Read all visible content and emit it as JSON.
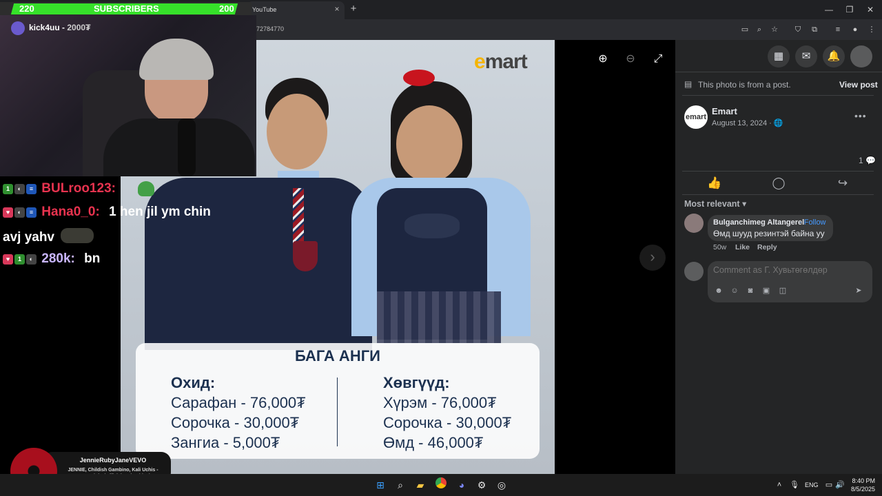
{
  "browser": {
    "tab_title": "YouTube",
    "tab_close": "×",
    "new_tab": "+",
    "url": "72784770",
    "window": {
      "minimize": "—",
      "restore": "❐",
      "close": "✕"
    }
  },
  "stream_overlay": {
    "subscriber_goal": {
      "left": "220",
      "label": "SUBSCRIBERS",
      "right": "200"
    },
    "alert": {
      "user": "kick4uu",
      "separator": " - ",
      "amount": "2000₮"
    },
    "chat": [
      {
        "badges": [
          "1st",
          "mask",
          "flag"
        ],
        "user": "BULroo123:",
        "user_color": "#e8334f",
        "message": ""
      },
      {
        "badges": [
          "heart",
          "mask",
          "flag"
        ],
        "user": "Hana0_0:",
        "user_color": "#e8334f",
        "message": "1 hen jil ym chin"
      },
      {
        "badges": [],
        "user": "avj yahv",
        "user_color": "#ffffff",
        "message": ""
      },
      {
        "badges": [
          "heart",
          "1st",
          "mask"
        ],
        "user": "280k:",
        "user_color": "#ffffff",
        "message": "bn"
      }
    ],
    "now_playing": {
      "title": "JennieRubyJaneVEVO",
      "subtitle": "JENNIE, Childish Gambino, Kali Uchis - Damn Right (Official Lyric Video)"
    }
  },
  "photo": {
    "logo": {
      "e": "e",
      "rest": "mart"
    },
    "card": {
      "title": "БАГА АНГИ",
      "girls": {
        "heading": "Охид:",
        "items": [
          "Сарафан - 76,000₮",
          "Сорочка - 30,000₮",
          "Зангиа - 5,000₮"
        ]
      },
      "boys": {
        "heading": "Хөвгүүд:",
        "items": [
          "Хүрэм - 76,000₮",
          "Сорочка - 30,000₮",
          "Өмд - 46,000₮"
        ]
      }
    },
    "controls": {
      "zoom_in": "⊕",
      "zoom_out": "⊖",
      "fullscreen": "⤢",
      "next": "›"
    }
  },
  "facebook": {
    "photo_note": "This photo is from a post.",
    "view_post": "View post",
    "page_name": "Emart",
    "page_avatar_text": "emart",
    "post_date": "August 13, 2024 · 🌐",
    "more": "•••",
    "comment_count": "1 💬",
    "sort_label": "Most relevant ▾",
    "comment": {
      "author": "Bulganchimeg Altangerel",
      "follow": "· Follow",
      "text": "Өмд шууд резинтэй байна уу",
      "age": "50w",
      "like": "Like",
      "reply": "Reply"
    },
    "comment_placeholder": "Comment as Г. Хувьтөгөлдөр",
    "send": "➤"
  },
  "taskbar": {
    "language": "ENG",
    "time": "8:40 PM",
    "date": "8/5/2025"
  },
  "colors": {
    "subscriber_fill": "#36e12a",
    "fb_background": "#242526",
    "fb_link": "#4599ff",
    "card_text": "#1c3150",
    "logo_e": "#f5b400"
  }
}
